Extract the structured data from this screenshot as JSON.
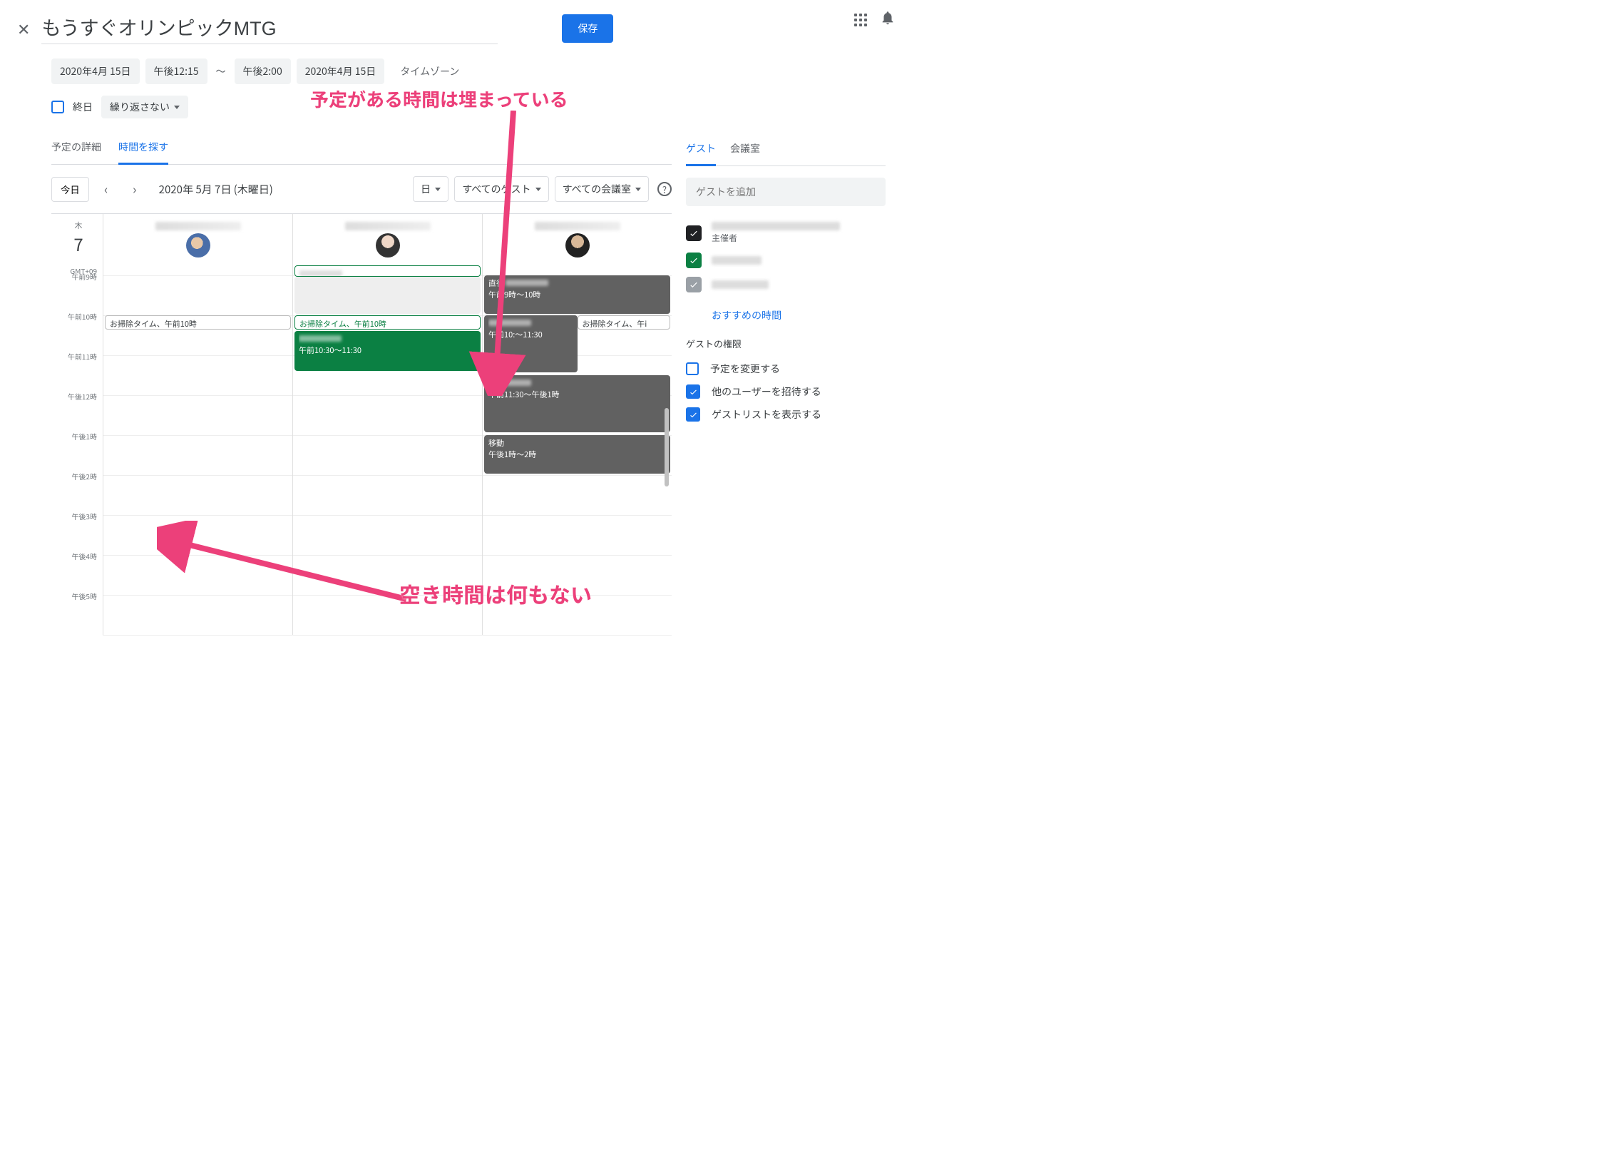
{
  "title": "もうすぐオリンピックMTG",
  "save_button": "保存",
  "date_start": "2020年4月 15日",
  "time_start": "午後12:15",
  "range_separator": "〜",
  "time_end": "午後2:00",
  "date_end": "2020年4月 15日",
  "timezone_link": "タイムゾーン",
  "allday_label": "終日",
  "repeat_label": "繰り返さない",
  "tabs": {
    "details": "予定の詳細",
    "findtime": "時間を探す"
  },
  "toolbar": {
    "today": "今日",
    "date_display": "2020年 5月 7日 (木曜日)",
    "day_mode": "日",
    "all_guests": "すべてのゲスト",
    "all_rooms": "すべての会議室"
  },
  "day_header": {
    "weekday": "木",
    "daynum": "7"
  },
  "gmt": "GMT+09",
  "hours": [
    "午前9時",
    "午前10時",
    "午前11時",
    "午後12時",
    "午後1時",
    "午後2時",
    "午後3時",
    "午後4時",
    "午後5時"
  ],
  "events": {
    "col1_clean": "お掃除タイム、午前10時",
    "col2_clean": "お掃除タイム、午前10時",
    "col2_mtg_time": "午前10:30〜11:30",
    "col3_direct": "直行",
    "col3_direct_time": "午前9時〜10時",
    "col3_clean": "お掃除タイム、午i",
    "col3_b1_time": "午前10:〜11:30",
    "col3_b2_time": "午前11:30〜午後1時",
    "col3_move": "移動",
    "col3_move_time": "午後1時〜2時"
  },
  "side": {
    "guest_tab": "ゲスト",
    "room_tab": "会議室",
    "guest_placeholder": "ゲストを追加",
    "organizer_sub": "主催者",
    "suggested": "おすすめの時間",
    "perm_title": "ゲストの権限",
    "perm_modify": "予定を変更する",
    "perm_invite": "他のユーザーを招待する",
    "perm_seelist": "ゲストリストを表示する"
  },
  "annotations": {
    "busy": "予定がある時間は埋まっている",
    "free": "空き時間は何もない"
  }
}
